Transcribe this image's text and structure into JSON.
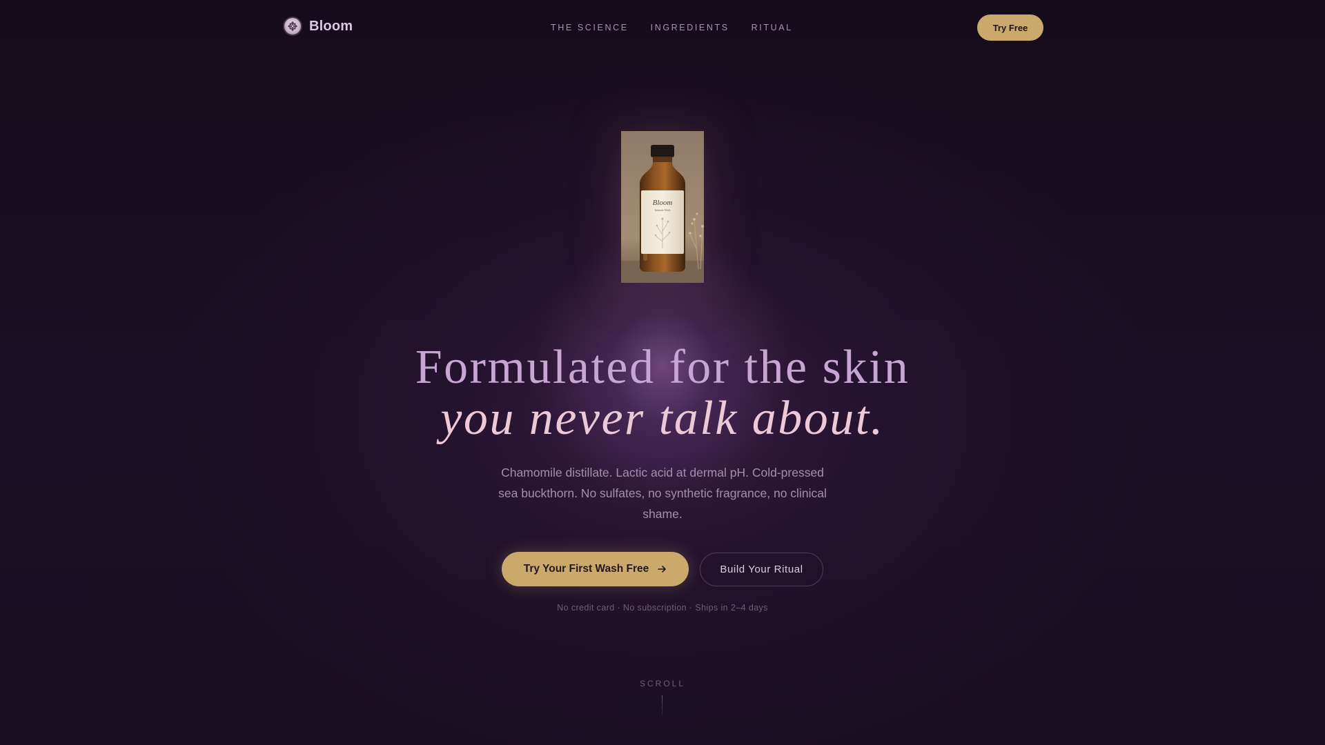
{
  "brand": {
    "name": "Bloom",
    "logo_icon": "flower-emblem-icon"
  },
  "nav": {
    "links": [
      {
        "label": "THE SCIENCE"
      },
      {
        "label": "INGREDIENTS"
      },
      {
        "label": "RITUAL"
      }
    ],
    "cta_label": "Try Free"
  },
  "hero": {
    "product_image": {
      "label_brand": "Bloom",
      "label_sub": "Intimate Wash"
    },
    "title_line1": "Formulated for the skin",
    "title_line2": "you never talk about.",
    "subtitle": "Chamomile distillate. Lactic acid at dermal pH. Cold-pressed sea buckthorn. No sulfates, no synthetic fragrance, no clinical shame.",
    "primary_cta": {
      "label": "Try Your First Wash Free",
      "icon": "arrow-right-icon"
    },
    "secondary_cta": {
      "label": "Build Your Ritual"
    },
    "fineprint": "No credit card · No subscription · Ships in 2–4 days"
  },
  "scroll_hint": {
    "label": "SCROLL"
  },
  "colors": {
    "background": "#170d1e",
    "accent_gold": "#cba96c",
    "title_lavender": "#c7a6d3",
    "title_pink": "#ecc9d6",
    "body_text": "#a191a8"
  }
}
